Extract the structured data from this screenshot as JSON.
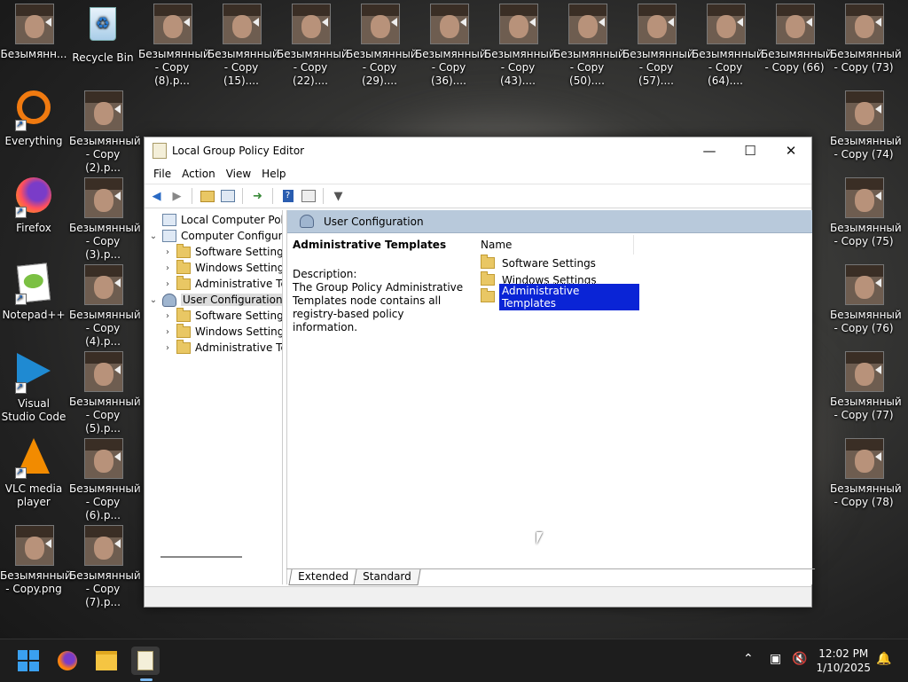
{
  "desktop": {
    "icons": [
      {
        "label": "Безымянн...",
        "kind": "face"
      },
      {
        "label": "Recycle Bin",
        "kind": "recycle"
      },
      {
        "label": "Безымянный - Copy (8).p...",
        "kind": "face"
      },
      {
        "label": "Безымянный - Copy (15)....",
        "kind": "face"
      },
      {
        "label": "Безымянный - Copy (22)....",
        "kind": "face"
      },
      {
        "label": "Безымянный - Copy (29)....",
        "kind": "face"
      },
      {
        "label": "Безымянный - Copy (36)....",
        "kind": "face"
      },
      {
        "label": "Безымянный - Copy (43)....",
        "kind": "face"
      },
      {
        "label": "Безымянный - Copy (50)....",
        "kind": "face"
      },
      {
        "label": "Безымянный - Copy (57)....",
        "kind": "face"
      },
      {
        "label": "Безымянный - Copy (64)....",
        "kind": "face"
      },
      {
        "label": "Безымянный - Copy (66)",
        "kind": "face"
      },
      {
        "label": "Безымянный - Copy (73)",
        "kind": "face"
      },
      {
        "label": "Everything",
        "kind": "everything"
      },
      {
        "label": "Безымянный - Copy (2).p...",
        "kind": "face"
      },
      {
        "label": "Безымянный - Copy (74)",
        "kind": "face"
      },
      {
        "label": "Firefox",
        "kind": "firefox"
      },
      {
        "label": "Безымянный - Copy (3).p...",
        "kind": "face"
      },
      {
        "label": "Безымянный - Copy (75)",
        "kind": "face"
      },
      {
        "label": "Notepad++",
        "kind": "notepad"
      },
      {
        "label": "Безымянный - Copy (4).p...",
        "kind": "face"
      },
      {
        "label": "Безымянный - Copy (76)",
        "kind": "face"
      },
      {
        "label": "Visual Studio Code",
        "kind": "vscode"
      },
      {
        "label": "Безымянный - Copy (5).p...",
        "kind": "face"
      },
      {
        "label": "Безымянный - Copy (77)",
        "kind": "face"
      },
      {
        "label": "VLC media player",
        "kind": "vlc"
      },
      {
        "label": "Безымянный - Copy (6).p...",
        "kind": "face"
      },
      {
        "label": "Безымянный - Copy (78)",
        "kind": "face"
      },
      {
        "label": "Безымянный - Copy.png",
        "kind": "face"
      },
      {
        "label": "Безымянный - Copy (7).p...",
        "kind": "face"
      }
    ]
  },
  "window": {
    "title": "Local Group Policy Editor",
    "menu": [
      "File",
      "Action",
      "View",
      "Help"
    ],
    "tree": [
      {
        "label": "Local Computer Policy",
        "expander": "",
        "icon": "policy",
        "selected": false
      },
      {
        "label": "Computer Configura",
        "expander": "⌄",
        "icon": "pc",
        "selected": false
      },
      {
        "label": "Software Settings",
        "expander": "›",
        "icon": "folder",
        "selected": false
      },
      {
        "label": "Windows Setting",
        "expander": "›",
        "icon": "folder",
        "selected": false
      },
      {
        "label": "Administrative Te",
        "expander": "›",
        "icon": "folder",
        "selected": false
      },
      {
        "label": "User Configuration",
        "expander": "⌄",
        "icon": "user",
        "selected": true
      },
      {
        "label": "Software Settings",
        "expander": "›",
        "icon": "folder",
        "selected": false
      },
      {
        "label": "Windows Setting",
        "expander": "›",
        "icon": "folder",
        "selected": false
      },
      {
        "label": "Administrative Te",
        "expander": "›",
        "icon": "folder",
        "selected": false
      }
    ],
    "content": {
      "header": "User Configuration",
      "desc_title": "Administrative Templates",
      "desc_label": "Description:",
      "desc_text": "The Group Policy Administrative Templates node contains all registry-based policy information.",
      "column_name": "Name",
      "items": [
        {
          "label": "Software Settings",
          "selected": false
        },
        {
          "label": "Windows Settings",
          "selected": false
        },
        {
          "label": "Administrative Templates",
          "selected": true
        }
      ]
    },
    "tabs": [
      "Extended",
      "Standard"
    ]
  },
  "taskbar": {
    "time": "12:02 PM",
    "date": "1/10/2025"
  }
}
